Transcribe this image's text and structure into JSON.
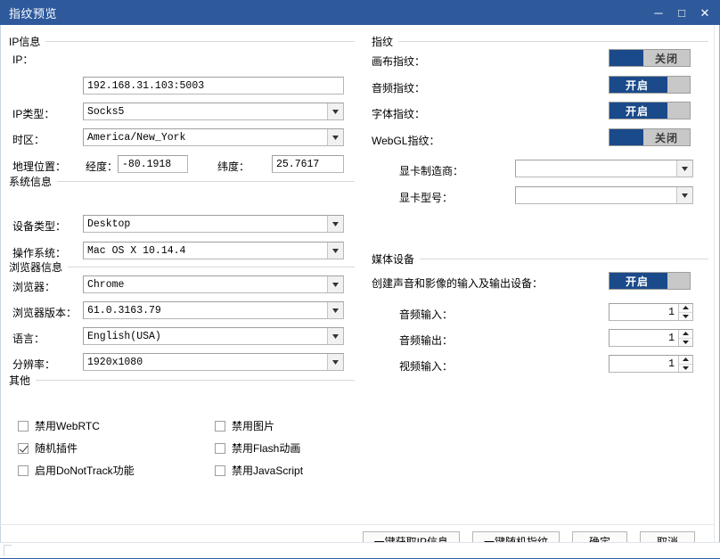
{
  "window": {
    "title": "指纹预览",
    "minimize": "─",
    "maximize": "□",
    "close": "✕"
  },
  "ip_section": {
    "title": "IP信息",
    "ip_label": "IP：",
    "ip_value": "192.168.31.103:5003",
    "ip_type_label": "IP类型：",
    "ip_type_value": "Socks5",
    "timezone_label": "时区：",
    "timezone_value": "America/New_York",
    "geo_label": "地理位置：",
    "longitude_label": "经度：",
    "longitude_value": "-80.1918",
    "latitude_label": "纬度：",
    "latitude_value": "25.7617"
  },
  "system_section": {
    "title": "系统信息",
    "device_label": "设备类型：",
    "device_value": "Desktop",
    "os_label": "操作系统：",
    "os_value": "Mac OS X 10.14.4"
  },
  "browser_section": {
    "title": "浏览器信息",
    "browser_label": "浏览器：",
    "browser_value": "Chrome",
    "version_label": "浏览器版本：",
    "version_value": "61.0.3163.79",
    "language_label": "语言：",
    "language_value": "English(USA)",
    "resolution_label": "分辨率：",
    "resolution_value": "1920x1080"
  },
  "other_section": {
    "title": "其他",
    "checkboxes": [
      {
        "label": "禁用WebRTC",
        "checked": false
      },
      {
        "label": "随机插件",
        "checked": true
      },
      {
        "label": "启用DoNotTrack功能",
        "checked": false
      },
      {
        "label": "禁用图片",
        "checked": false
      },
      {
        "label": "禁用Flash动画",
        "checked": false
      },
      {
        "label": "禁用JavaScript",
        "checked": false
      }
    ]
  },
  "fingerprint_section": {
    "title": "指纹",
    "canvas_label": "画布指纹：",
    "canvas_state": "关闭",
    "audio_label": "音频指纹：",
    "audio_state": "开启",
    "font_label": "字体指纹：",
    "font_state": "开启",
    "webgl_label": "WebGL指纹：",
    "webgl_state": "关闭",
    "gpu_vendor_label": "显卡制造商：",
    "gpu_vendor_value": "",
    "gpu_model_label": "显卡型号：",
    "gpu_model_value": ""
  },
  "media_section": {
    "title": "媒体设备",
    "create_devices_label": "创建声音和影像的输入及输出设备：",
    "create_devices_state": "开启",
    "audio_in_label": "音频输入：",
    "audio_in_value": "1",
    "audio_out_label": "音频输出：",
    "audio_out_value": "1",
    "video_in_label": "视频输入：",
    "video_in_value": "1"
  },
  "footer": {
    "get_ip_label": "一键获取IP信息",
    "random_fp_label": "一键随机指纹",
    "ok_label": "确定",
    "cancel_label": "取消"
  },
  "colors": {
    "titlebar": "#2e5a9c",
    "toggle_on": "#1a4a8a",
    "toggle_track": "#c8c8c8"
  }
}
